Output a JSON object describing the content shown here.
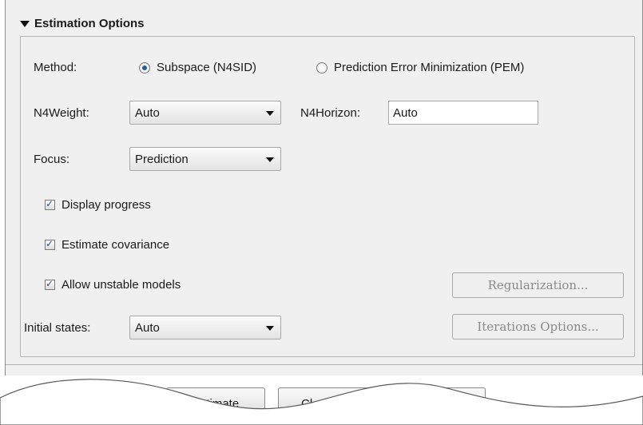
{
  "section": {
    "title": "Estimation Options"
  },
  "method": {
    "label": "Method:",
    "options": [
      {
        "label": "Subspace (N4SID)",
        "selected": true
      },
      {
        "label": "Prediction Error Minimization (PEM)",
        "selected": false
      }
    ]
  },
  "n4weight": {
    "label": "N4Weight:",
    "value": "Auto"
  },
  "n4horizon": {
    "label": "N4Horizon:",
    "value": "Auto"
  },
  "focus": {
    "label": "Focus:",
    "value": "Prediction"
  },
  "checkboxes": [
    {
      "label": "Display progress",
      "checked": true
    },
    {
      "label": "Estimate covariance",
      "checked": true
    },
    {
      "label": "Allow unstable models",
      "checked": true
    }
  ],
  "initial_states": {
    "label": "Initial states:",
    "value": "Auto"
  },
  "buttons": {
    "regularization": "Regularization...",
    "iterations": "Iterations Options...",
    "estimate": "Estimate",
    "close_partial": "Cl"
  }
}
